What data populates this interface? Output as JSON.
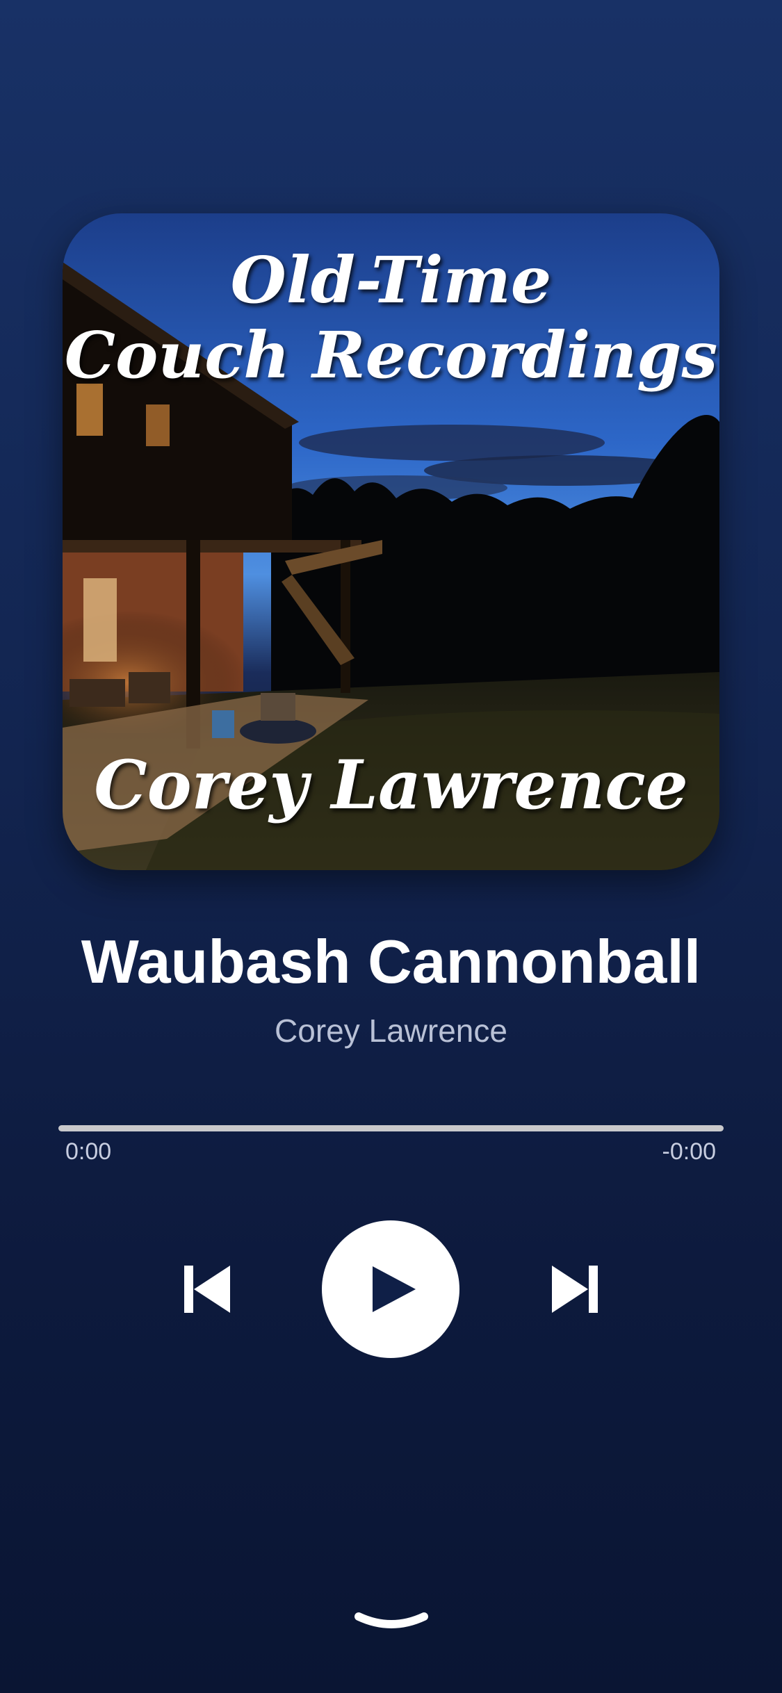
{
  "artwork": {
    "title_line1": "Old-Time",
    "title_line2": "Couch Recordings",
    "artist": "Corey Lawrence"
  },
  "track": {
    "title": "Waubash Cannonball",
    "artist": "Corey Lawrence"
  },
  "progress": {
    "elapsed": "0:00",
    "remaining": "-0:00",
    "fraction": 0
  },
  "controls": {
    "previous": "previous-track-icon",
    "play": "play-icon",
    "next": "next-track-icon",
    "collapse": "chevron-down-icon"
  },
  "colors": {
    "background_top": "#183166",
    "background_bottom": "#0a1533",
    "accent": "#ffffff",
    "secondary_text": "#b9c1d6"
  }
}
